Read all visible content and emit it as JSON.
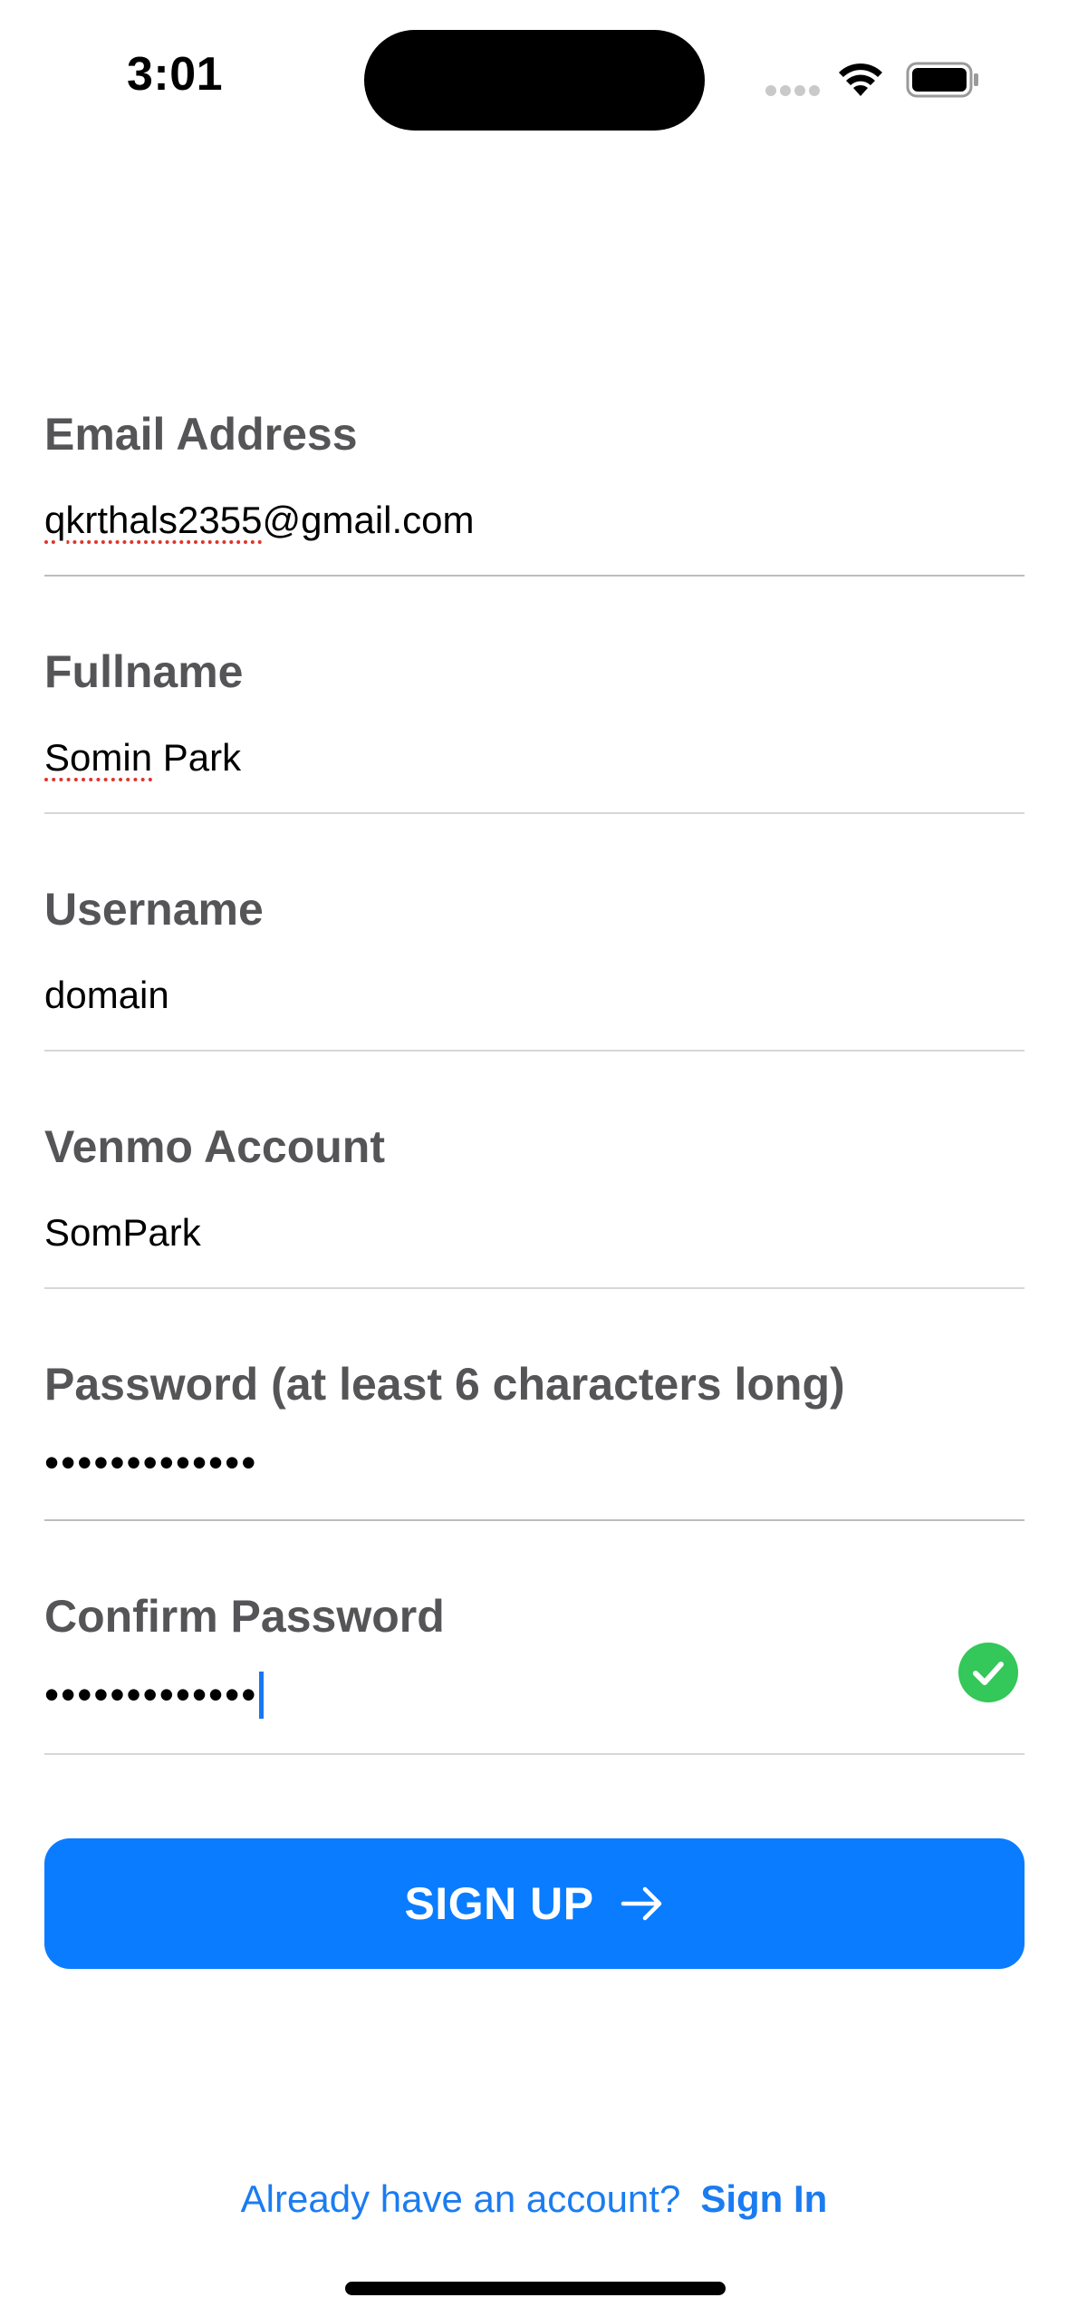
{
  "status_bar": {
    "time": "3:01"
  },
  "form": {
    "email": {
      "label": "Email Address",
      "value_misspelled": "qkrthals2355",
      "value_rest": "@gmail.com"
    },
    "fullname": {
      "label": "Fullname",
      "value_misspelled": "Somin",
      "value_rest": " Park"
    },
    "username": {
      "label": "Username",
      "value": "domain"
    },
    "venmo": {
      "label": "Venmo Account",
      "value": "SomPark"
    },
    "password": {
      "label": "Password (at least 6 characters long)",
      "masked_value": "•••••••••••••"
    },
    "confirm_password": {
      "label": "Confirm Password",
      "masked_value": "•••••••••••••",
      "match_icon": "checkmark-circle-icon",
      "match_color": "#34c759"
    }
  },
  "signup_button": {
    "label": "SIGN UP",
    "icon": "arrow-right-icon",
    "color": "#0a7cff"
  },
  "footer": {
    "prompt": "Already have an account?",
    "link": "Sign In",
    "link_color": "#1b7cf0"
  }
}
